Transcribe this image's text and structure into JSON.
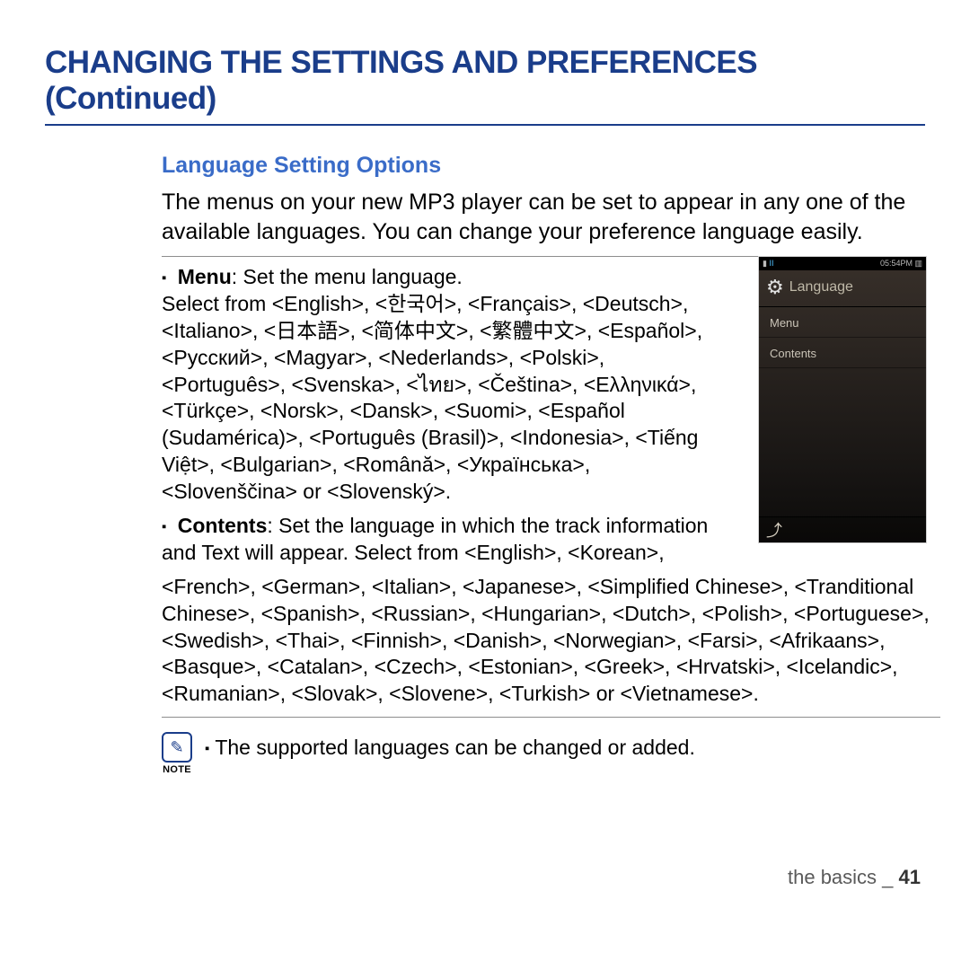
{
  "title": "CHANGING THE SETTINGS AND PREFERENCES (Continued)",
  "subsection": "Language Setting Options",
  "intro": "The menus on your new MP3 player can be set to appear in any one of the available languages. You can change your preference language easily.",
  "bullet1": {
    "label": "Menu",
    "desc_intro": ": Set the menu language.",
    "desc_body": "Select from <English>, <한국어>, <Français>, <Deutsch>, <Italiano>, <日本語>, <简体中文>, <繁體中文>, <Español>, <Русский>, <Magyar>, <Nederlands>, <Polski>, <Português>, <Svenska>, <ไทย>, <Čeština>, <Eλληνικά>, <Türkçe>, <Norsk>, <Dansk>, <Suomi>, <Español (Sudamérica)>, <Português (Brasil)>, <Indonesia>, <Tiếng Việt>, <Bulgarian>, <Română>, <Українська>, <Slovenščina> or <Slovenský>."
  },
  "bullet2": {
    "label": "Contents",
    "desc_intro": ": Set the language in which the track information and Text will appear. Select from <English>, <Korean>,",
    "desc_body": "<French>, <German>, <Italian>, <Japanese>, <Simplified Chinese>, <Tranditional Chinese>, <Spanish>, <Russian>, <Hungarian>, <Dutch>, <Polish>, <Portuguese>, <Swedish>, <Thai>, <Finnish>, <Danish>, <Norwegian>, <Farsi>, <Afrikaans>, <Basque>, <Catalan>, <Czech>, <Estonian>, <Greek>, <Hrvatski>, <Icelandic>, <Rumanian>, <Slovak>, <Slovene>, <Turkish> or <Vietnamese>."
  },
  "note": {
    "label": "NOTE",
    "text": "The supported languages can be changed or added."
  },
  "screen": {
    "status_time": "05:54PM",
    "title": "Language",
    "item1": "Menu",
    "item2": "Contents"
  },
  "footer": {
    "section": "the basics _",
    "page": " 41"
  }
}
